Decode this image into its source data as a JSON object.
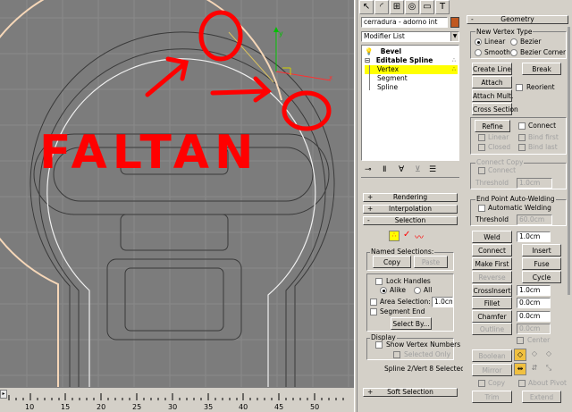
{
  "object_name": "cerradura - adorno int",
  "object_color": "#c05820",
  "modifier_list": "Modifier List",
  "stack": {
    "items": [
      "Bevel",
      "Editable Spline",
      "Vertex",
      "Segment",
      "Spline"
    ],
    "selected": "Vertex"
  },
  "annotation": {
    "text": "FALTAN",
    "color": "#ff0000"
  },
  "axis_labels": {
    "y": "y",
    "x": "x"
  },
  "left_rollouts": {
    "rendering": "Rendering",
    "interpolation": "Interpolation",
    "selection": "Selection",
    "soft_selection": "Soft Selection",
    "named_selections": "Named Selections:",
    "copy": "Copy",
    "paste": "Paste",
    "lock_handles": "Lock Handles",
    "alike": "Alike",
    "all": "All",
    "area_selection": "Area Selection:",
    "area_value": "1.0cm",
    "segment_end": "Segment End",
    "select_by": "Select By...",
    "display": "Display",
    "show_vertex_numbers": "Show Vertex Numbers",
    "selected_only": "Selected Only",
    "status": "Spline 2/Vert 8 Selected"
  },
  "geometry": {
    "title": "Geometry",
    "new_vertex_type": "New Vertex Type",
    "linear": "Linear",
    "bezier": "Bezier",
    "smooth": "Smooth",
    "bezier_corner": "Bezier Corner",
    "create_line": "Create Line",
    "break": "Break",
    "attach": "Attach",
    "attach_mult": "Attach Mult.",
    "reorient": "Reorient",
    "cross_section": "Cross Section",
    "refine": "Refine",
    "connect": "Connect",
    "linear2": "Linear",
    "bind_first": "Bind first",
    "closed": "Closed",
    "bind_last": "Bind last",
    "connect_copy": "Connect Copy",
    "connect2": "Connect",
    "threshold": "Threshold",
    "threshold_value": "1.0cm",
    "end_point_auto_welding": "End Point Auto-Welding",
    "automatic_welding": "Automatic Welding",
    "threshold2": "Threshold",
    "threshold2_value": "60.0cm",
    "weld": "Weld",
    "weld_value": "1.0cm",
    "connect_btn": "Connect",
    "insert": "Insert",
    "make_first": "Make First",
    "fuse": "Fuse",
    "reverse": "Reverse",
    "cycle": "Cycle",
    "cross_insert": "CrossInsert",
    "cross_insert_value": "1.0cm",
    "fillet": "Fillet",
    "fillet_value": "0.0cm",
    "chamfer": "Chamfer",
    "chamfer_value": "0.0cm",
    "outline": "Outline",
    "outline_value": "0.0cm",
    "center": "Center",
    "boolean": "Boolean",
    "mirror": "Mirror",
    "copy": "Copy",
    "about_pivot": "About Pivot",
    "trim": "Trim",
    "extend": "Extend"
  },
  "timeline": {
    "ticks": [
      "10",
      "15",
      "20",
      "25",
      "30",
      "35",
      "40",
      "45",
      "50"
    ]
  }
}
